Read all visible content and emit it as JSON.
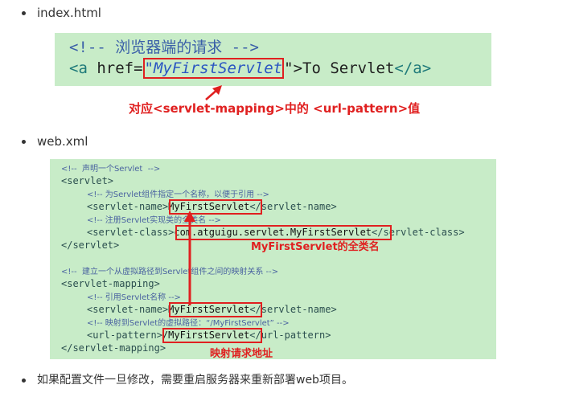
{
  "bullets": {
    "index": "index.html",
    "web": "web.xml",
    "note": "如果配置文件一旦修改，需要重启服务器来重新部署web项目。"
  },
  "code1": {
    "comment": "<!-- 浏览器端的请求 -->",
    "open_tag": "<a ",
    "attr": "href=",
    "value": "\"MyFirstServlet",
    "close_quote": "\">",
    "text": "To Servlet",
    "end_tag": "</a>"
  },
  "annot1": "对应<servlet-mapping>中的  <url-pattern>值",
  "code2": {
    "l1_comment": "<!--  声明一个Servlet  -->",
    "l2": "<servlet>",
    "l3_comment": "<!-- 为Servlet组件指定一个名称，以便于引用 -->",
    "l4_open": "<servlet-name>",
    "l4_val": "MyFirstServlet",
    "l4_close": "</servlet-name>",
    "l5_comment": "<!-- 注册Servlet实现类的全类名 -->",
    "l6_open": "<servlet-class>",
    "l6_val": "com.atguigu.servlet.MyFirstServlet",
    "l6_close": "</servlet-class>",
    "l7": "</servlet>",
    "l9_comment": "<!--  建立一个从虚拟路径到Servlet组件之间的映射关系 -->",
    "l10": "<servlet-mapping>",
    "l11_comment": "<!-- 引用Servlet名称 -->",
    "l12_open": "<servlet-name>",
    "l12_val": "MyFirstServlet",
    "l12_close": "</servlet-name>",
    "l13_comment": "<!-- 映射到Servlet的虚拟路径：“/MyFirstServlet” -->",
    "l14_open": "<url-pattern>",
    "l14_val": "/MyFirstServlet",
    "l14_close": "</url-pattern>",
    "l15": "</servlet-mapping>"
  },
  "annot_fullname": "MyFirstServlet的全类名",
  "annot_map": "映射请求地址",
  "colors": {
    "accent_red": "#e02020",
    "code_bg": "#c8ecc8"
  }
}
